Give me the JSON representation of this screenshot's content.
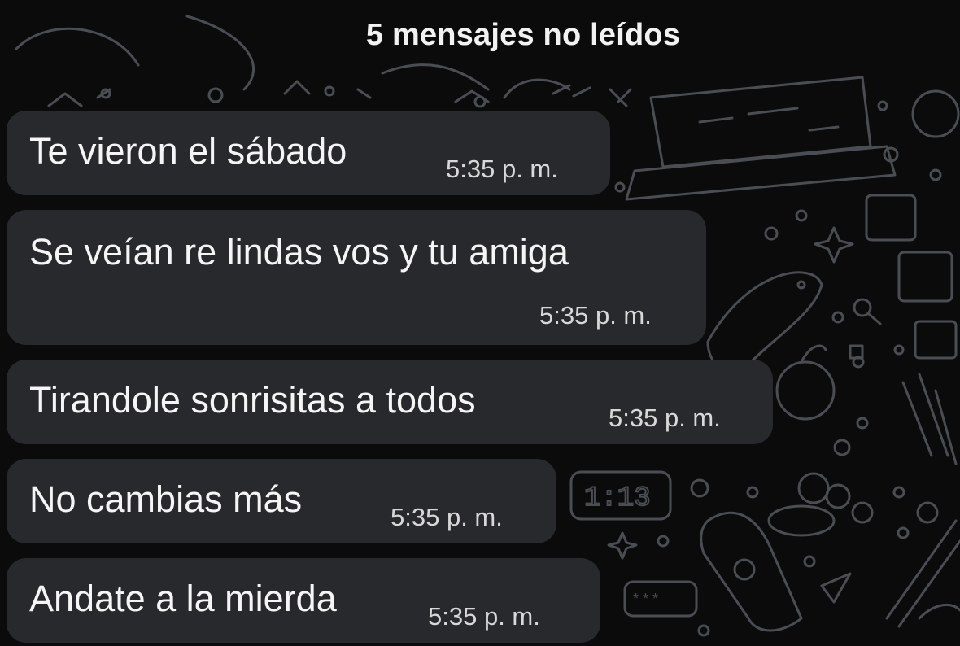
{
  "header": {
    "unread_label": "5 mensajes no leídos"
  },
  "messages": [
    {
      "text": "Te vieron el sábado",
      "time": "5:35 p. m."
    },
    {
      "text": "Se veían re lindas vos y tu amiga",
      "time": "5:35 p. m."
    },
    {
      "text": "Tirandole sonrisitas a todos",
      "time": "5:35 p. m."
    },
    {
      "text": "No cambias más",
      "time": "5:35 p. m."
    },
    {
      "text": "Andate a la mierda",
      "time": "5:35 p. m."
    }
  ],
  "wallpaper": {
    "clock_doodle_text": "1:13"
  },
  "colors": {
    "background": "#0b0b0c",
    "bubble": "#27292d",
    "text": "#f5f5f5",
    "timestamp": "#d8d8d8",
    "doodle": "#4a4d52"
  }
}
